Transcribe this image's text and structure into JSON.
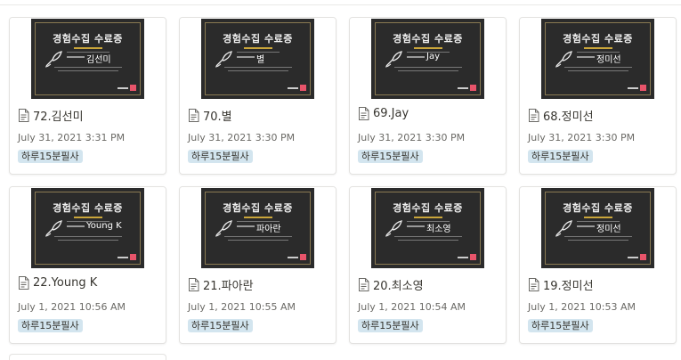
{
  "gallery": {
    "cards": [
      {
        "title": "72.김선미",
        "date": "July 31, 2021 3:31 PM",
        "tag": "하루15분필사",
        "cover": {
          "heading": "경험수집 수료증",
          "name": "김선미"
        }
      },
      {
        "title": "70.별",
        "date": "July 31, 2021 3:30 PM",
        "tag": "하루15분필사",
        "cover": {
          "heading": "경험수집 수료증",
          "name": "별"
        }
      },
      {
        "title": "69.Jay",
        "date": "July 31, 2021 3:30 PM",
        "tag": "하루15분필사",
        "cover": {
          "heading": "경험수집 수료증",
          "name": "Jay"
        }
      },
      {
        "title": "68.정미선",
        "date": "July 31, 2021 3:30 PM",
        "tag": "하루15분필사",
        "cover": {
          "heading": "경험수집 수료증",
          "name": "정미선"
        }
      },
      {
        "title": "22.Young K",
        "date": "July 1, 2021 10:56 AM",
        "tag": "하루15분필사",
        "cover": {
          "heading": "경험수집 수료증",
          "name": "Young K"
        }
      },
      {
        "title": "21.파아란",
        "date": "July 1, 2021 10:55 AM",
        "tag": "하루15분필사",
        "cover": {
          "heading": "경험수집 수료증",
          "name": "파아란"
        }
      },
      {
        "title": "20.최소영",
        "date": "July 1, 2021 10:54 AM",
        "tag": "하루15분필사",
        "cover": {
          "heading": "경험수집 수료증",
          "name": "최소영"
        }
      },
      {
        "title": "19.정미선",
        "date": "July 1, 2021 10:53 AM",
        "tag": "하루15분필사",
        "cover": {
          "heading": "경험수집 수료증",
          "name": "정미선"
        }
      }
    ]
  },
  "colors": {
    "tag_bg": "#d3e5ef",
    "cover_bg": "#2b2b2b",
    "accent": "#c9a53a",
    "logo": "#e8546a"
  },
  "icons": {
    "page": "page-icon",
    "pen": "fountain-pen-icon"
  }
}
